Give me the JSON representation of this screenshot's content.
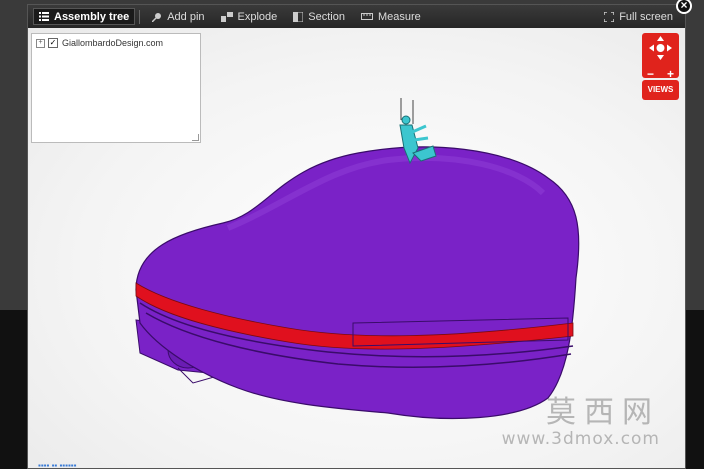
{
  "toolbar": {
    "assembly_tree": "Assembly tree",
    "add_pin": "Add pin",
    "explode": "Explode",
    "section": "Section",
    "measure": "Measure",
    "full_screen": "Full screen"
  },
  "tree": {
    "root_label": "GiallombardoDesign.com",
    "root_checked": true
  },
  "nav": {
    "views_label": "VIEWS",
    "zoom_out": "−",
    "zoom_in": "+"
  },
  "watermark": {
    "chinese": "莫西网",
    "url": "www.3dmox.com"
  },
  "colors": {
    "model_body": "#7a22c7",
    "model_band": "#e0101e",
    "pilot": "#3cc6cf",
    "accent_button": "#e0231c"
  }
}
